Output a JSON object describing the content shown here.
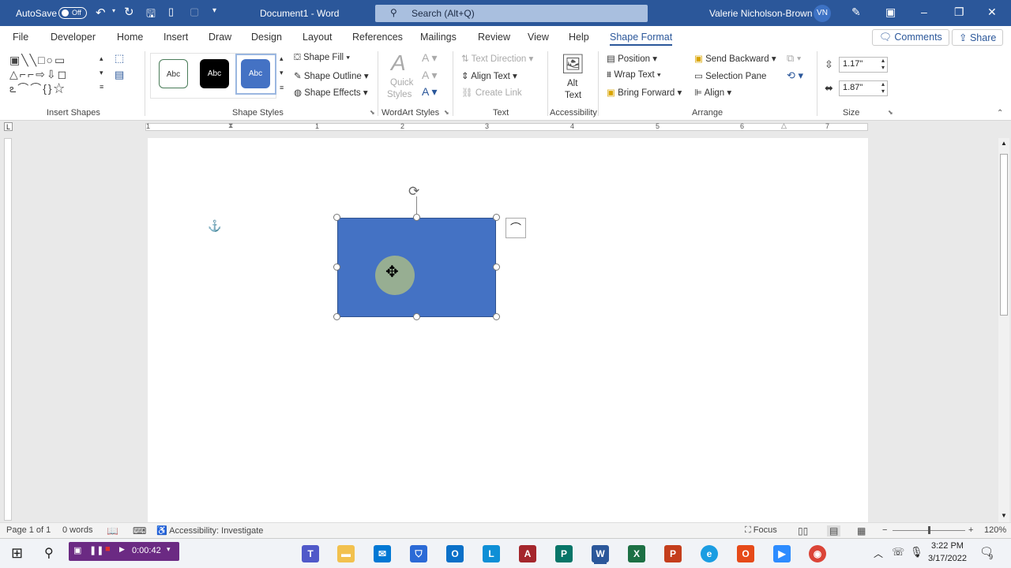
{
  "titlebar": {
    "autosave_label": "AutoSave",
    "autosave_state": "Off",
    "doc_title": "Document1 - Word",
    "search_placeholder": "Search (Alt+Q)",
    "user_name": "Valerie Nicholson-Brown",
    "user_initials": "VN"
  },
  "tabs": [
    "File",
    "Developer",
    "Home",
    "Insert",
    "Draw",
    "Design",
    "Layout",
    "References",
    "Mailings",
    "Review",
    "View",
    "Help",
    "Shape Format"
  ],
  "active_tab": "Shape Format",
  "actions": {
    "comments": "Comments",
    "share": "Share"
  },
  "ribbon": {
    "insert_shapes": {
      "label": "Insert Shapes"
    },
    "shape_styles": {
      "label": "Shape Styles",
      "thumb_text": "Abc",
      "fill": "Shape Fill",
      "outline": "Shape Outline",
      "effects": "Shape Effects"
    },
    "wordart": {
      "label": "WordArt Styles",
      "quick_styles_1": "Quick",
      "quick_styles_2": "Styles"
    },
    "text": {
      "label": "Text",
      "direction": "Text Direction",
      "align": "Align Text",
      "link": "Create Link"
    },
    "accessibility": {
      "label": "Accessibility",
      "alt_1": "Alt",
      "alt_2": "Text"
    },
    "arrange": {
      "label": "Arrange",
      "position": "Position",
      "wrap": "Wrap Text",
      "forward": "Bring Forward",
      "backward": "Send Backward",
      "selection": "Selection Pane",
      "align": "Align"
    },
    "size": {
      "label": "Size",
      "height": "1.17\"",
      "width": "1.87\""
    }
  },
  "ruler_numbers": [
    "1",
    "1",
    "2",
    "3",
    "4",
    "5",
    "6",
    "7"
  ],
  "status": {
    "page": "Page 1 of 1",
    "words": "0 words",
    "accessibility": "Accessibility: Investigate",
    "focus": "Focus",
    "zoom": "120%"
  },
  "taskbar": {
    "recorder_time": "0:00:42",
    "time": "3:22 PM",
    "date": "3/17/2022",
    "notifications": "9"
  },
  "colors": {
    "title_bar": "#2b579a",
    "shape_fill": "#4472c4",
    "accent": "#2b579a"
  }
}
